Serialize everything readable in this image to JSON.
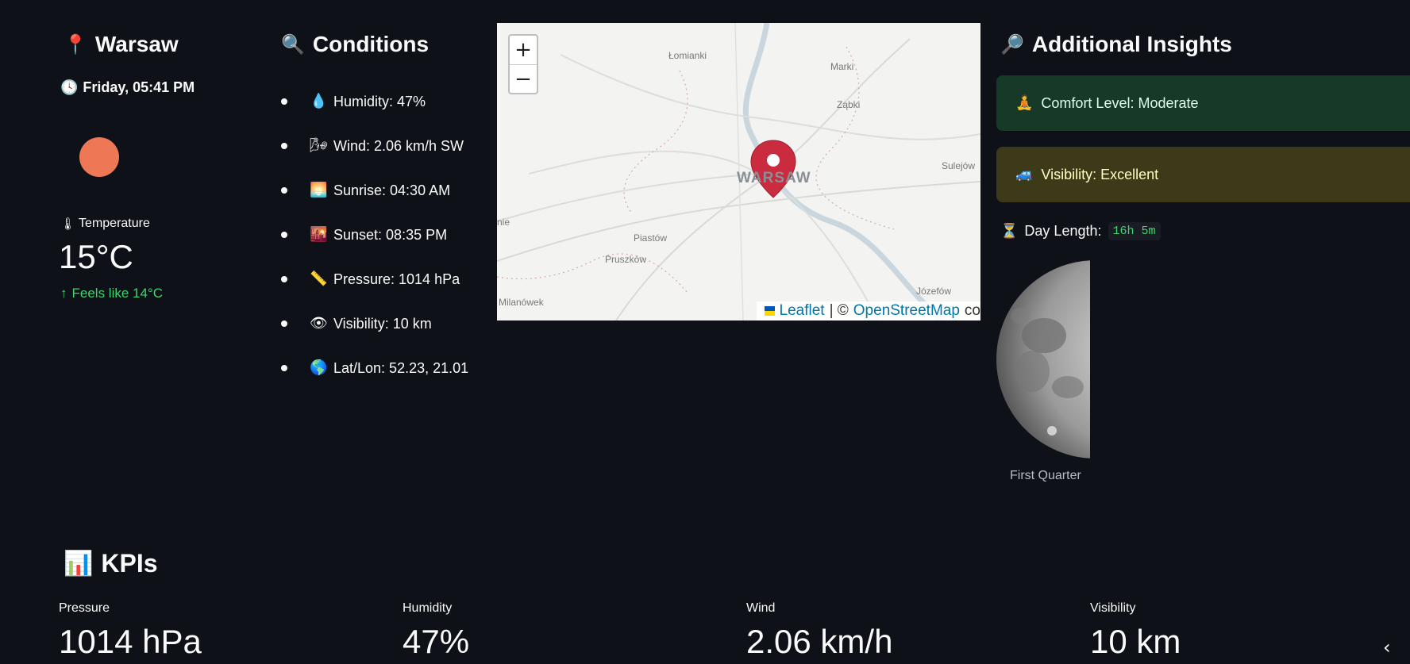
{
  "location": {
    "city": "Warsaw",
    "pin_icon": "round-pushpin-icon",
    "datetime": "Friday, 05:41 PM",
    "clock_icon": "clock-icon",
    "sun_color": "#ee7755"
  },
  "temperature": {
    "label": "Temperature",
    "value": "15°C",
    "feels_like": "Feels like 14°C",
    "feels_color": "#3dd56d"
  },
  "conditions": {
    "title": "Conditions",
    "items": [
      {
        "icon": "droplet-icon",
        "glyph": "💧",
        "text": "Humidity: 47%"
      },
      {
        "icon": "wind-icon",
        "glyph": "🌬",
        "text": "Wind: 2.06 km/h SW"
      },
      {
        "icon": "sunrise-icon",
        "glyph": "🌅",
        "text": "Sunrise: 04:30 AM"
      },
      {
        "icon": "sunset-icon",
        "glyph": "🌇",
        "text": "Sunset: 08:35 PM"
      },
      {
        "icon": "ruler-icon",
        "glyph": "📏",
        "text": "Pressure: 1014 hPa"
      },
      {
        "icon": "eye-icon",
        "glyph": "👁",
        "text": "Visibility: 10 km"
      },
      {
        "icon": "globe-icon",
        "glyph": "🌎",
        "text": "Lat/Lon: 52.23, 21.01"
      }
    ]
  },
  "map": {
    "zoom_in": "+",
    "zoom_out": "−",
    "city_label": "WARSAW",
    "places": [
      "Łomianki",
      "Marki",
      "Ząbki",
      "Sulejów",
      "Piastów",
      "Pruszków",
      "Józefów",
      "Milanówek",
      "nie"
    ],
    "attribution": {
      "leaflet": "Leaflet",
      "sep": "| ©",
      "osm": "OpenStreetMap",
      "tail": "co"
    }
  },
  "insights": {
    "title": "Additional Insights",
    "comfort": "Comfort Level: Moderate",
    "visibility": "Visibility: Excellent",
    "day_length_label": "Day Length:",
    "day_length_value": "16h 5m",
    "moon_phase": "First Quarter"
  },
  "kpis": {
    "title": "KPIs",
    "items": [
      {
        "label": "Pressure",
        "value": "1014 hPa"
      },
      {
        "label": "Humidity",
        "value": "47%"
      },
      {
        "label": "Wind",
        "value": "2.06 km/h"
      },
      {
        "label": "Visibility",
        "value": "10 km"
      }
    ]
  },
  "sidebar_toggle": "‹"
}
